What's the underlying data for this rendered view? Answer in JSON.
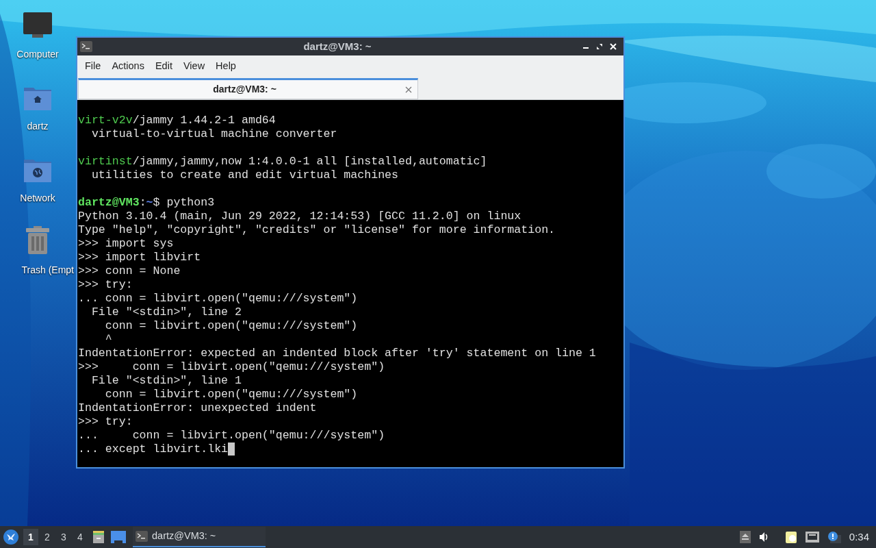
{
  "desktop_icons": [
    {
      "kind": "computer",
      "label": "Computer"
    },
    {
      "kind": "home",
      "label": "dartz"
    },
    {
      "kind": "network",
      "label": "Network"
    },
    {
      "kind": "trash",
      "label": "Trash (Empt"
    }
  ],
  "window": {
    "title": "dartz@VM3: ~",
    "menu": [
      "File",
      "Actions",
      "Edit",
      "View",
      "Help"
    ],
    "tabs": [
      {
        "label": "dartz@VM3: ~",
        "selected": true
      }
    ],
    "terminal_lines": [
      [
        {
          "kind": "green",
          "text": "virt-v2v"
        },
        {
          "kind": "plain",
          "text": "/jammy 1.44.2-1 amd64"
        }
      ],
      [
        {
          "kind": "plain",
          "text": "  virtual-to-virtual machine converter"
        }
      ],
      [
        {
          "kind": "blank"
        }
      ],
      [
        {
          "kind": "green",
          "text": "virtinst"
        },
        {
          "kind": "plain",
          "text": "/jammy,jammy,now 1:4.0.0-1 all [installed,automatic]"
        }
      ],
      [
        {
          "kind": "plain",
          "text": "  utilities to create and edit virtual machines"
        }
      ],
      [
        {
          "kind": "blank"
        }
      ],
      [
        {
          "kind": "prompt_user",
          "text": "dartz@VM3"
        },
        {
          "kind": "plain",
          "text": ":"
        },
        {
          "kind": "prompt_path",
          "text": "~"
        },
        {
          "kind": "plain",
          "text": "$ python3"
        }
      ],
      [
        {
          "kind": "plain",
          "text": "Python 3.10.4 (main, Jun 29 2022, 12:14:53) [GCC 11.2.0] on linux"
        }
      ],
      [
        {
          "kind": "plain",
          "text": "Type \"help\", \"copyright\", \"credits\" or \"license\" for more information."
        }
      ],
      [
        {
          "kind": "plain",
          "text": ">>> import sys"
        }
      ],
      [
        {
          "kind": "plain",
          "text": ">>> import libvirt"
        }
      ],
      [
        {
          "kind": "plain",
          "text": ">>> conn = None"
        }
      ],
      [
        {
          "kind": "plain",
          "text": ">>> try:"
        }
      ],
      [
        {
          "kind": "plain",
          "text": "... conn = libvirt.open(\"qemu:///system\")"
        }
      ],
      [
        {
          "kind": "plain",
          "text": "  File \"<stdin>\", line 2"
        }
      ],
      [
        {
          "kind": "plain",
          "text": "    conn = libvirt.open(\"qemu:///system\")"
        }
      ],
      [
        {
          "kind": "plain",
          "text": "    ^"
        }
      ],
      [
        {
          "kind": "plain",
          "text": "IndentationError: expected an indented block after 'try' statement on line 1"
        }
      ],
      [
        {
          "kind": "plain",
          "text": ">>>     conn = libvirt.open(\"qemu:///system\")"
        }
      ],
      [
        {
          "kind": "plain",
          "text": "  File \"<stdin>\", line 1"
        }
      ],
      [
        {
          "kind": "plain",
          "text": "    conn = libvirt.open(\"qemu:///system\")"
        }
      ],
      [
        {
          "kind": "plain",
          "text": "IndentationError: unexpected indent"
        }
      ],
      [
        {
          "kind": "plain",
          "text": ">>> try:"
        }
      ],
      [
        {
          "kind": "plain",
          "text": "...     conn = libvirt.open(\"qemu:///system\")"
        }
      ],
      [
        {
          "kind": "plain",
          "text": "... except libvirt.lki"
        }
      ]
    ]
  },
  "taskbar": {
    "workspaces": [
      {
        "label": "1",
        "selected": true
      },
      {
        "label": "2",
        "selected": false
      },
      {
        "label": "3",
        "selected": false
      },
      {
        "label": "4",
        "selected": false
      }
    ],
    "task": {
      "label": "dartz@VM3: ~",
      "selected": true
    },
    "clock": "0:34"
  }
}
